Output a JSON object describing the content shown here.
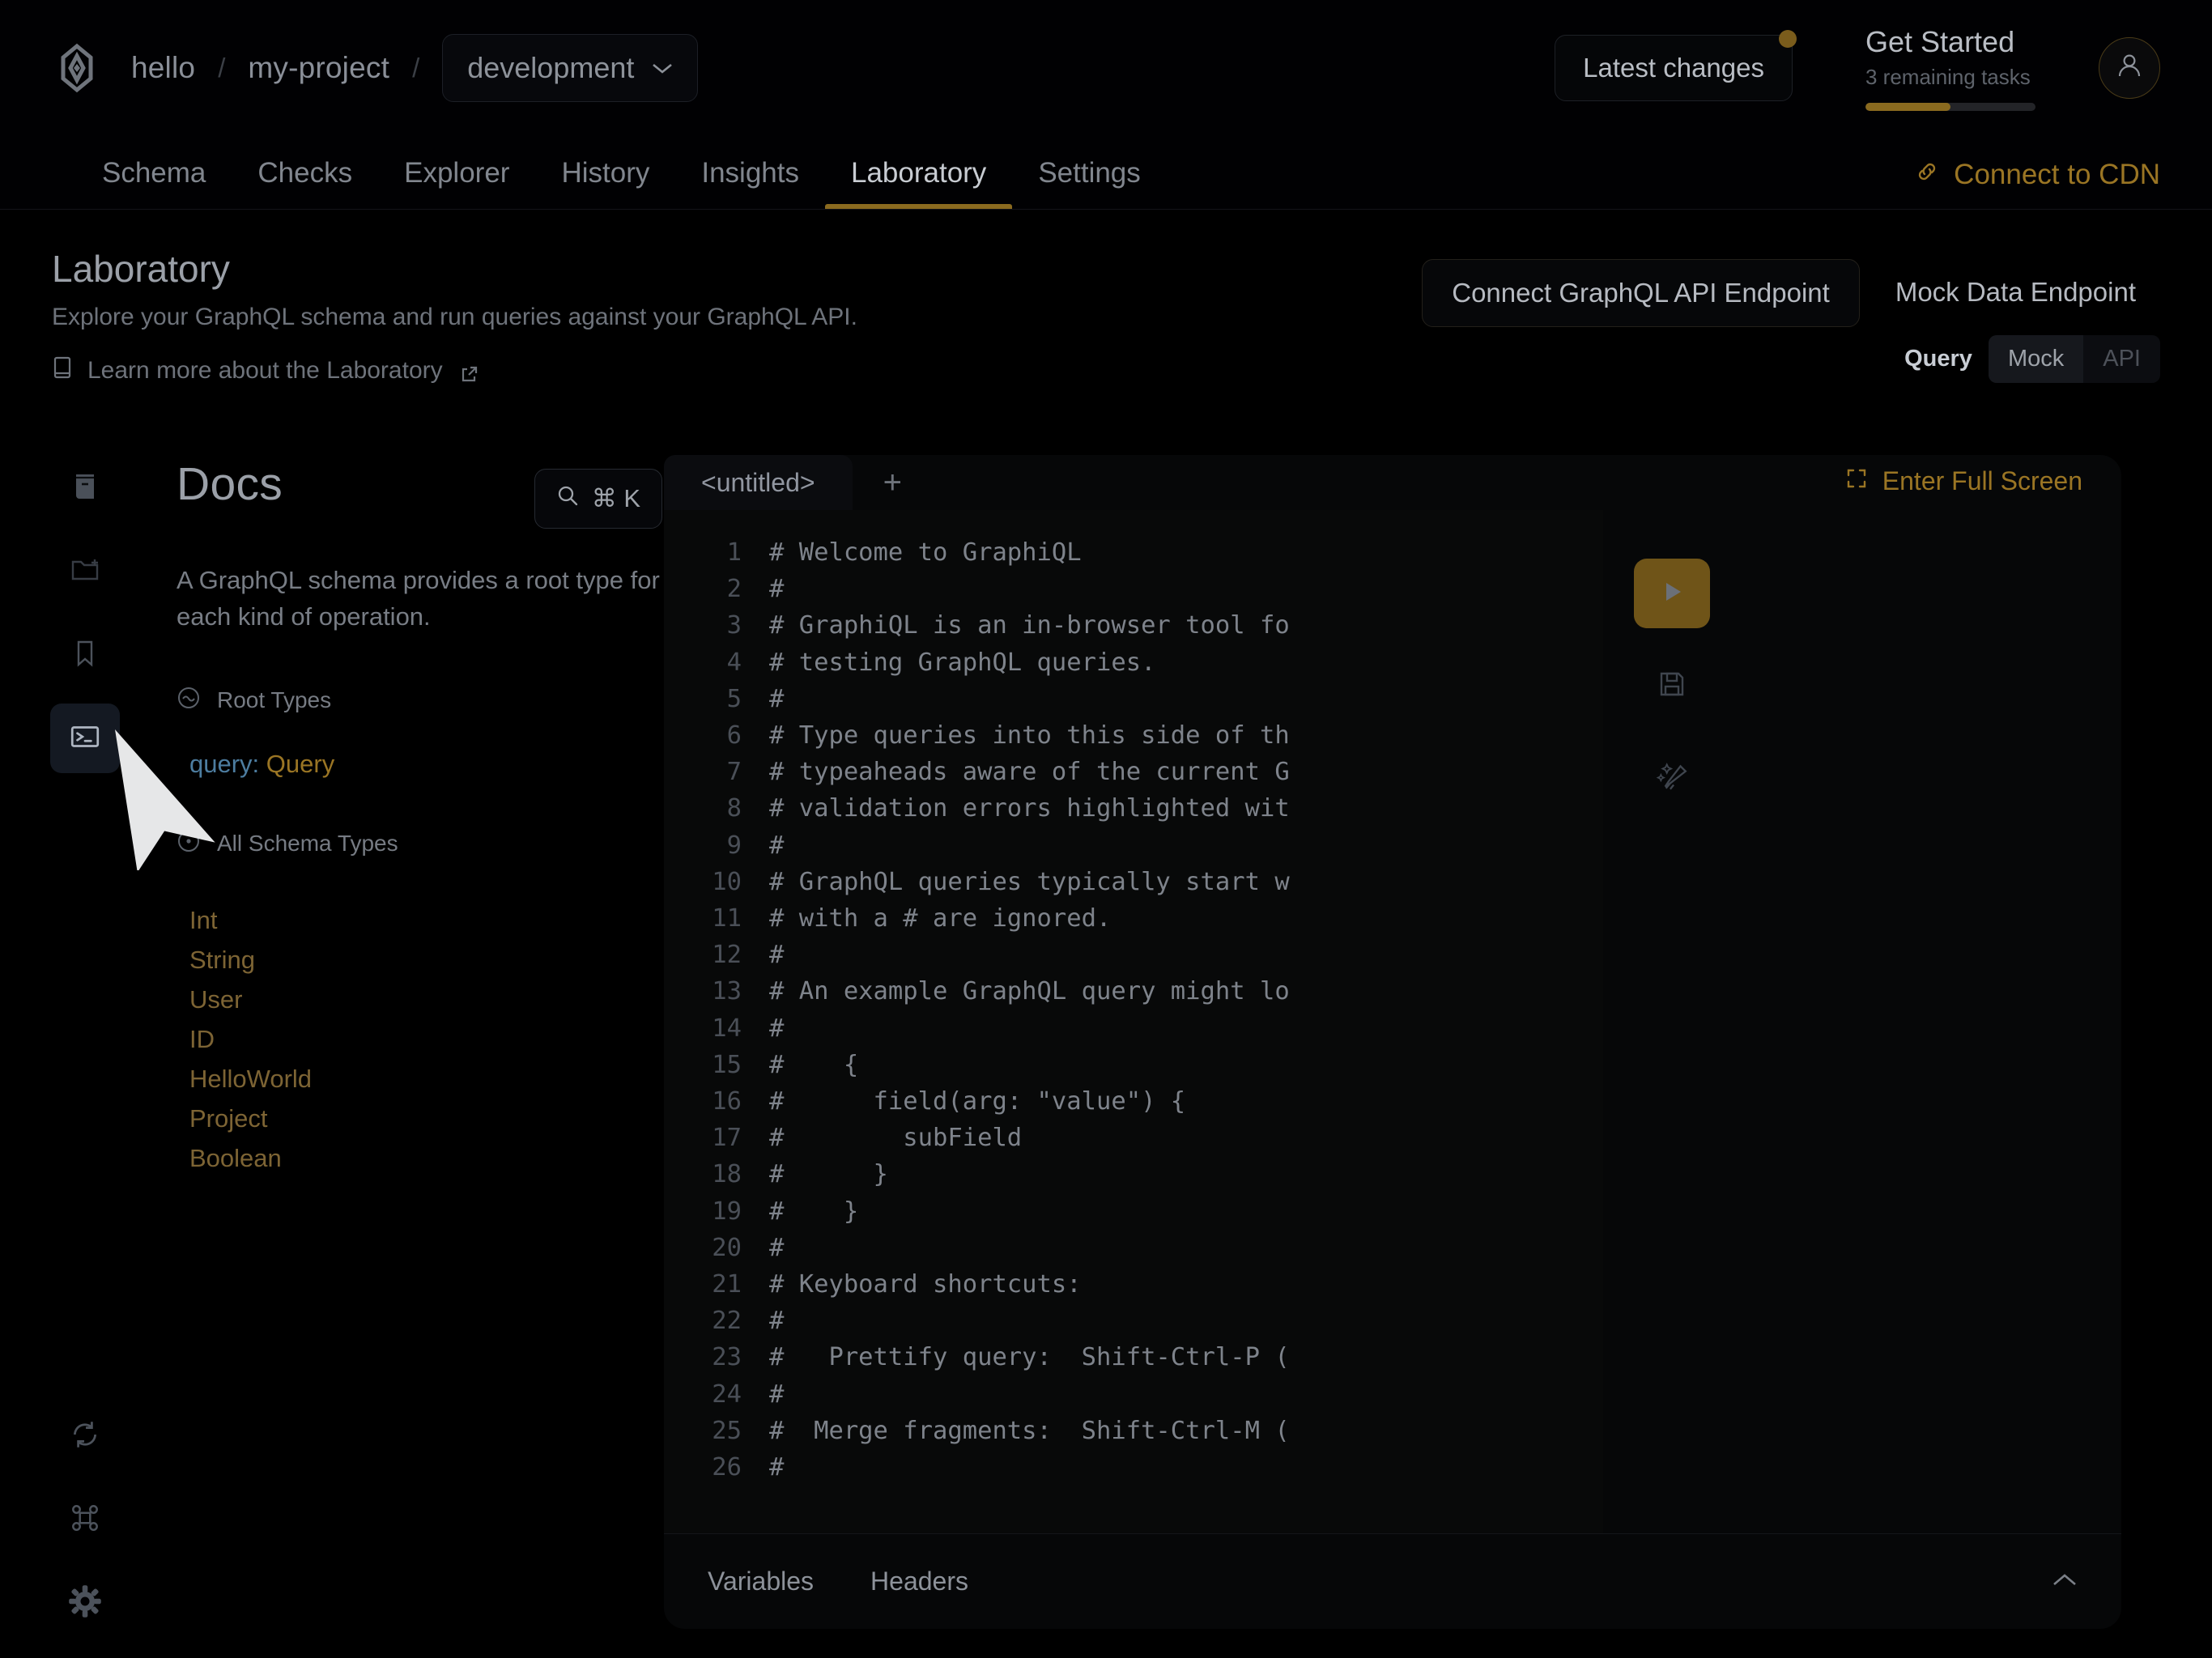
{
  "topbar": {
    "logo_icon": "hive-logo-icon",
    "breadcrumb": {
      "org": "hello",
      "project": "my-project",
      "separator": "/"
    },
    "environment": {
      "label": "development",
      "chevron_icon": "chevron-down-icon"
    },
    "latest_changes_label": "Latest changes",
    "get_started": {
      "title": "Get Started",
      "subtitle": "3 remaining tasks",
      "progress_percent": 50
    },
    "avatar_icon": "user-avatar-icon"
  },
  "nav": {
    "tabs": [
      {
        "label": "Schema",
        "active": false
      },
      {
        "label": "Checks",
        "active": false
      },
      {
        "label": "Explorer",
        "active": false
      },
      {
        "label": "History",
        "active": false
      },
      {
        "label": "Insights",
        "active": false
      },
      {
        "label": "Laboratory",
        "active": true
      },
      {
        "label": "Settings",
        "active": false
      }
    ],
    "cdn_link": {
      "label": "Connect to CDN",
      "icon": "link-icon"
    }
  },
  "page": {
    "title": "Laboratory",
    "subtitle": "Explore your GraphQL schema and run queries against your GraphQL API.",
    "learn_more": {
      "label": "Learn more about the Laboratory",
      "icon": "book-icon",
      "external_icon": "external-link-icon"
    },
    "actions": {
      "connect_endpoint_label": "Connect GraphQL API Endpoint",
      "mock_data_label": "Mock Data Endpoint"
    },
    "mode_toggle": {
      "label": "Query",
      "options": [
        "Mock",
        "API"
      ],
      "selected": "Mock"
    }
  },
  "rail": {
    "items": [
      {
        "icon": "book-docs-icon",
        "name": "docs",
        "selected": false
      },
      {
        "icon": "folder-plus-icon",
        "name": "new-folder",
        "selected": false
      },
      {
        "icon": "bookmark-icon",
        "name": "bookmarks",
        "selected": false
      },
      {
        "icon": "terminal-icon",
        "name": "terminal",
        "selected": true
      }
    ],
    "bottom_items": [
      {
        "icon": "refresh-icon",
        "name": "refresh"
      },
      {
        "icon": "command-icon",
        "name": "shortcuts"
      },
      {
        "icon": "gear-icon",
        "name": "settings"
      }
    ]
  },
  "docs": {
    "title": "Docs",
    "search": {
      "label": "⌘ K",
      "icon": "search-icon"
    },
    "description": "A GraphQL schema provides a root type for each kind of operation.",
    "root_types_section": {
      "label": "Root Types",
      "icon": "squiggle-circle-icon"
    },
    "root_type_entry": {
      "key": "query:",
      "value": "Query"
    },
    "all_types_section": {
      "label": "All Schema Types",
      "icon": "dot-circle-icon"
    },
    "types": [
      "Int",
      "String",
      "User",
      "ID",
      "HelloWorld",
      "Project",
      "Boolean"
    ]
  },
  "editor": {
    "tabs": [
      {
        "label": "<untitled>",
        "active": true
      }
    ],
    "add_tab_label": "+",
    "fullscreen": {
      "label": "Enter Full Screen",
      "icon": "fullscreen-icon"
    },
    "actions": [
      {
        "name": "execute-query-button",
        "icon": "play-icon"
      },
      {
        "name": "save-query-button",
        "icon": "floppy-disk-icon"
      },
      {
        "name": "prettify-query-button",
        "icon": "magic-wand-icon"
      }
    ],
    "code_lines": [
      {
        "n": "1",
        "text": "# Welcome to GraphiQL"
      },
      {
        "n": "2",
        "text": "#"
      },
      {
        "n": "3",
        "text": "# GraphiQL is an in-browser tool fo"
      },
      {
        "n": "4",
        "text": "# testing GraphQL queries."
      },
      {
        "n": "5",
        "text": "#"
      },
      {
        "n": "6",
        "text": "# Type queries into this side of th"
      },
      {
        "n": "7",
        "text": "# typeaheads aware of the current G"
      },
      {
        "n": "8",
        "text": "# validation errors highlighted wit"
      },
      {
        "n": "9",
        "text": "#"
      },
      {
        "n": "10",
        "text": "# GraphQL queries typically start w"
      },
      {
        "n": "11",
        "text": "# with a # are ignored."
      },
      {
        "n": "12",
        "text": "#"
      },
      {
        "n": "13",
        "text": "# An example GraphQL query might lo"
      },
      {
        "n": "14",
        "text": "#"
      },
      {
        "n": "15",
        "text": "#    {"
      },
      {
        "n": "16",
        "text": "#      field(arg: \"value\") {"
      },
      {
        "n": "17",
        "text": "#        subField"
      },
      {
        "n": "18",
        "text": "#      }"
      },
      {
        "n": "19",
        "text": "#    }"
      },
      {
        "n": "20",
        "text": "#"
      },
      {
        "n": "21",
        "text": "# Keyboard shortcuts:"
      },
      {
        "n": "22",
        "text": "#"
      },
      {
        "n": "23",
        "text": "#   Prettify query:  Shift-Ctrl-P ("
      },
      {
        "n": "24",
        "text": "#"
      },
      {
        "n": "25",
        "text": "#  Merge fragments:  Shift-Ctrl-M ("
      },
      {
        "n": "26",
        "text": "#"
      }
    ],
    "footer": {
      "tabs": [
        "Variables",
        "Headers"
      ],
      "collapse_icon": "chevron-up-icon"
    }
  },
  "colors": {
    "accent_gold": "#8a6a1f",
    "accent_gold_text": "#9a7524",
    "background": "#000000",
    "panel": "#060708",
    "text_primary": "#b9bdc4",
    "text_muted": "#6e737b",
    "type_name": "#7d6434",
    "field_key": "#4d7da0"
  }
}
